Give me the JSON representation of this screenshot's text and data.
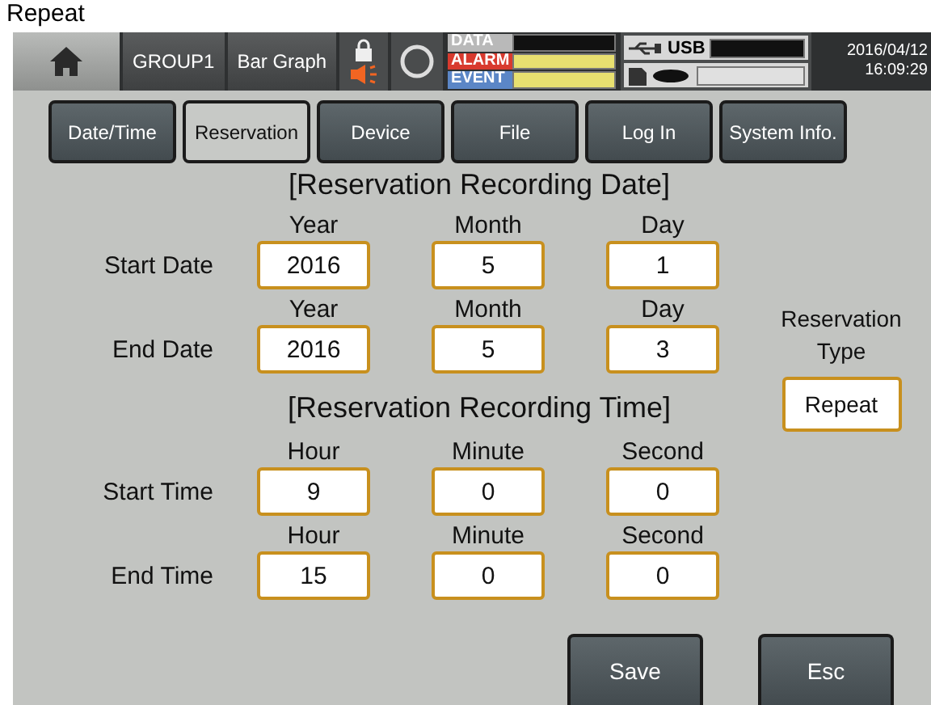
{
  "caption": "Repeat",
  "header": {
    "group": "GROUP1",
    "view": "Bar Graph",
    "indicators": [
      {
        "label": "DATA",
        "kind": "data"
      },
      {
        "label": "ALARM",
        "kind": "alarm"
      },
      {
        "label": "EVENT",
        "kind": "event"
      }
    ],
    "usb": "USB",
    "date": "2016/04/12",
    "time": "16:09:29"
  },
  "tabs": [
    {
      "label": "Date/Time",
      "selected": false
    },
    {
      "label": "Reservation",
      "selected": true
    },
    {
      "label": "Device",
      "selected": false
    },
    {
      "label": "File",
      "selected": false
    },
    {
      "label": "Log In",
      "selected": false
    },
    {
      "label": "System Info.",
      "selected": false
    }
  ],
  "date_section": {
    "title": "[Reservation Recording Date]",
    "rows": [
      {
        "label": "Start Date",
        "fields": [
          {
            "label": "Year",
            "value": "2016"
          },
          {
            "label": "Month",
            "value": "5"
          },
          {
            "label": "Day",
            "value": "1"
          }
        ]
      },
      {
        "label": "End Date",
        "fields": [
          {
            "label": "Year",
            "value": "2016"
          },
          {
            "label": "Month",
            "value": "5"
          },
          {
            "label": "Day",
            "value": "3"
          }
        ]
      }
    ]
  },
  "time_section": {
    "title": "[Reservation Recording Time]",
    "rows": [
      {
        "label": "Start Time",
        "fields": [
          {
            "label": "Hour",
            "value": "9"
          },
          {
            "label": "Minute",
            "value": "0"
          },
          {
            "label": "Second",
            "value": "0"
          }
        ]
      },
      {
        "label": "End Time",
        "fields": [
          {
            "label": "Hour",
            "value": "15"
          },
          {
            "label": "Minute",
            "value": "0"
          },
          {
            "label": "Second",
            "value": "0"
          }
        ]
      }
    ]
  },
  "reservation_type": {
    "label": "Reservation Type",
    "value": "Repeat"
  },
  "buttons": [
    "Save",
    "Esc"
  ]
}
